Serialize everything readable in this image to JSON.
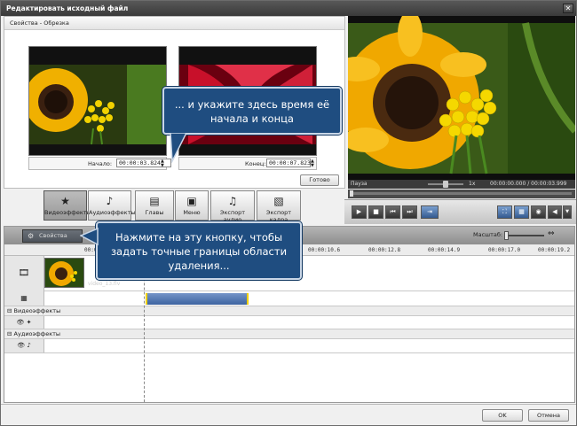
{
  "window": {
    "title": "Редактировать исходный файл"
  },
  "editor": {
    "header": "Свойства - Обрезка",
    "start_label": "Начало:",
    "start_value": "00:00:03.824",
    "end_label": "Конец:",
    "end_value": "00:00:07.823",
    "done_button": "Готово"
  },
  "player": {
    "status": "Пауза",
    "speed": "1x",
    "time": "00:00:00.000 / 00:00:03.999"
  },
  "toolbar": {
    "video_effects": "Видеоэффекты",
    "audio_effects": "Аудиоэффекты",
    "chapters": "Главы",
    "menu": "Меню",
    "export_audio": "Экспорт аудио",
    "export_frame": "Экспорт кадра"
  },
  "timeline": {
    "properties_button": "Свойства",
    "scale_label": "Масштаб:",
    "ticks": [
      "00:00:0",
      "00:00:10.6",
      "00:00:12.8",
      "00:00:14.9",
      "00:00:17.0",
      "00:00:19.2"
    ],
    "clip_name": "video_13.flv",
    "video_effects_section": "Видеоэффекты",
    "audio_effects_section": "Аудиоэффекты"
  },
  "callouts": {
    "top": "... и укажите здесь время её начала и конца",
    "bottom": "Нажмите на эту кнопку, чтобы задать точные границы области удаления..."
  },
  "footer": {
    "ok": "OK",
    "cancel": "Отмена"
  },
  "colors": {
    "callout_bg": "#1f4d80",
    "clip_blue": "#4a6fa5",
    "clip_edge": "#f0d000"
  }
}
